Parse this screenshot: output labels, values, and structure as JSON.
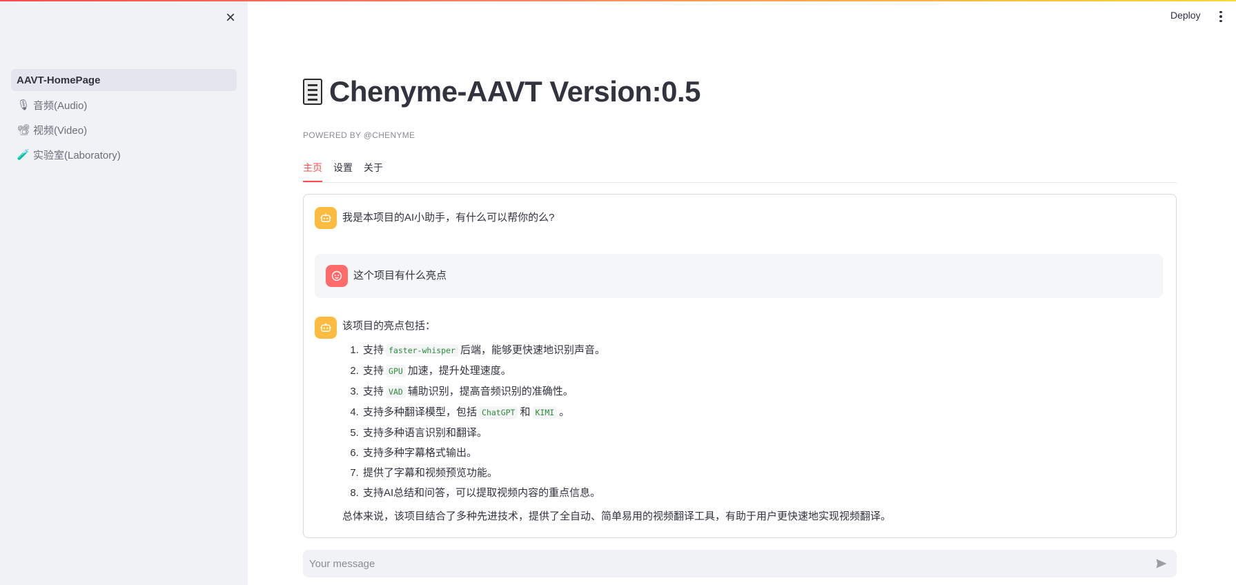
{
  "sidebar": {
    "close_icon": "×",
    "nav": [
      {
        "icon": "",
        "label": "AAVT-HomePage",
        "active": true
      },
      {
        "icon": "🎙",
        "label": "音频(Audio)"
      },
      {
        "icon": "📽",
        "label": "视频(Video)"
      },
      {
        "icon": "🧪",
        "label": "实验室(Laboratory)"
      }
    ]
  },
  "header": {
    "deploy_label": "Deploy"
  },
  "main": {
    "title": "Chenyme-AAVT Version:0.5",
    "subtitle": "POWERED BY @CHENYME",
    "tabs": [
      "主页",
      "设置",
      "关于"
    ]
  },
  "chat": {
    "greeting": "我是本项目的AI小助手，有什么可以帮你的么?",
    "question": "这个项目有什么亮点",
    "answer_intro": "该项目的亮点包括：",
    "points": [
      {
        "before": "支持",
        "code": "faster-whisper",
        "after": "后端，能够更快速地识别声音。"
      },
      {
        "before": "支持",
        "code": "GPU",
        "after": "加速，提升处理速度。"
      },
      {
        "before": "支持",
        "code": "VAD",
        "after": "辅助识别，提高音频识别的准确性。"
      },
      {
        "before": "支持多种翻译模型，包括",
        "code": "ChatGPT",
        "mid": "和",
        "code2": "KIMI",
        "after": "。"
      },
      {
        "text": "支持多种语言识别和翻译。"
      },
      {
        "text": "支持多种字幕格式输出。"
      },
      {
        "text": "提供了字幕和视频预览功能。"
      },
      {
        "text": "支持AI总结和问答，可以提取视频内容的重点信息。"
      }
    ],
    "summary": "总体来说，该项目结合了多种先进技术，提供了全自动、简单易用的视频翻译工具，有助于用户更快速地实现视频翻译。"
  },
  "input": {
    "placeholder": "Your message"
  },
  "colors": {
    "accent": "#ff4b4b",
    "bot_avatar": "#fdbc3f",
    "user_avatar": "#ff6b6b",
    "sidebar_bg": "#f0f2f6",
    "code_text": "#2e8b3a"
  }
}
